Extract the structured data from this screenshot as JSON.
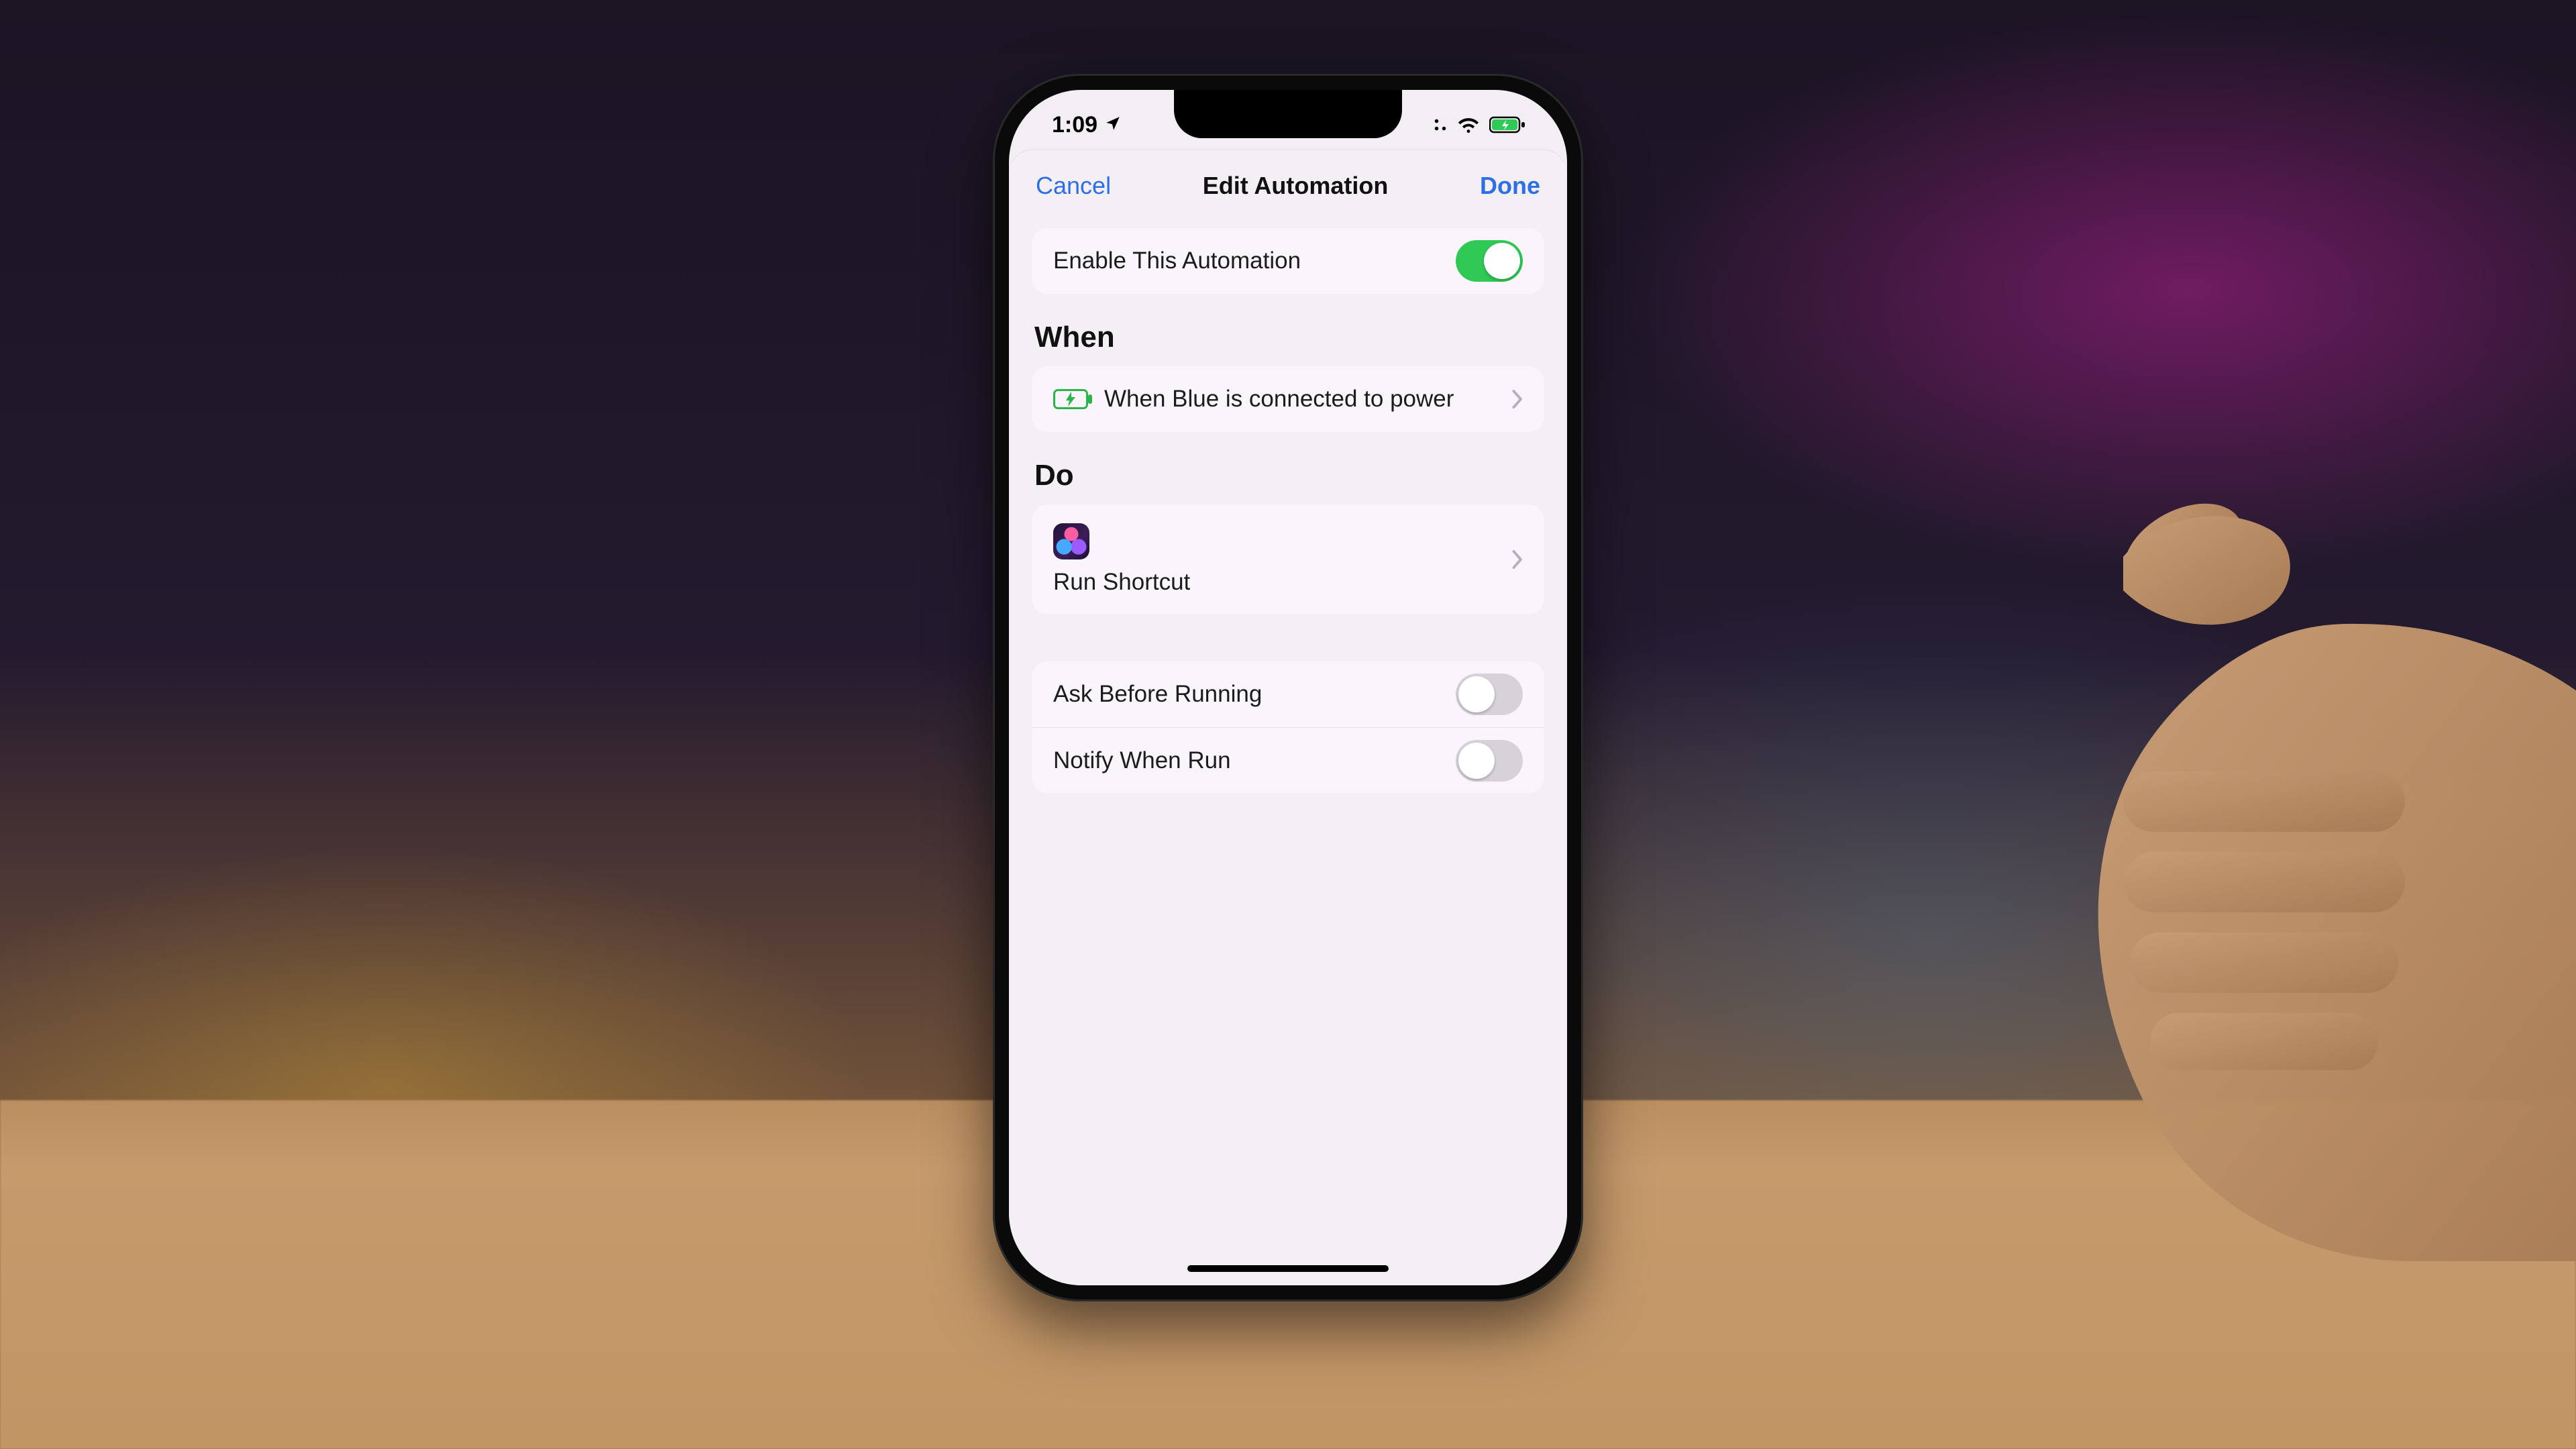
{
  "status": {
    "time": "1:09",
    "location_glyph": "◤",
    "wifi": true,
    "battery_charging": true
  },
  "nav": {
    "cancel": "Cancel",
    "title": "Edit Automation",
    "done": "Done"
  },
  "enable": {
    "label": "Enable This Automation",
    "on": true
  },
  "sections": {
    "when_title": "When",
    "do_title": "Do"
  },
  "when": {
    "label": "When Blue is connected to power",
    "icon": "battery-charging-icon"
  },
  "do": {
    "label": "Run Shortcut",
    "icon": "shortcuts-app-icon"
  },
  "options": {
    "ask_label": "Ask Before Running",
    "ask_on": false,
    "notify_label": "Notify When Run",
    "notify_on": false
  },
  "colors": {
    "accent": "#2f6fe0",
    "switch_on": "#34c759"
  }
}
